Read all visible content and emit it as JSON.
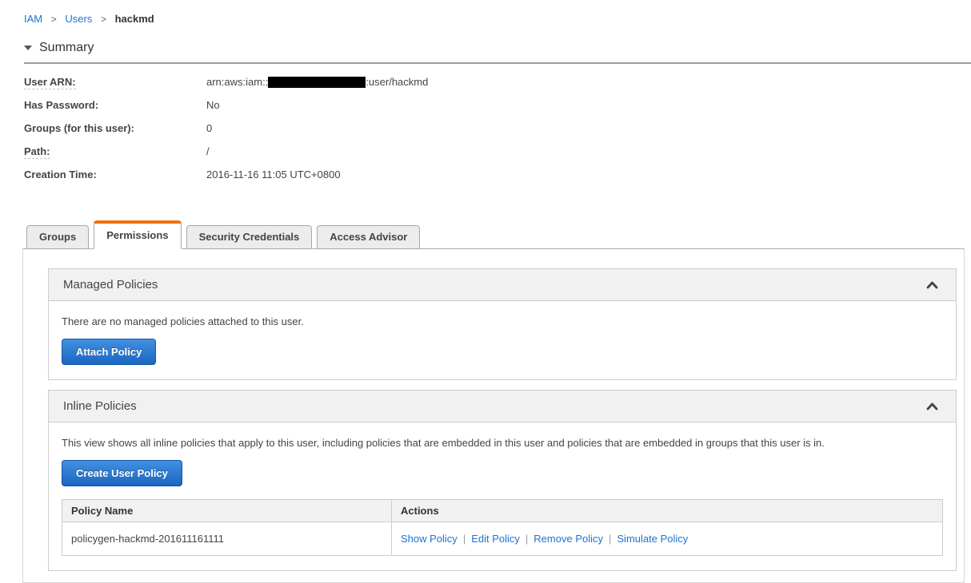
{
  "breadcrumb": {
    "separator": ">",
    "items": [
      {
        "label": "IAM"
      },
      {
        "label": "Users"
      },
      {
        "label": "hackmd"
      }
    ]
  },
  "summary": {
    "title": "Summary",
    "fields": [
      {
        "label": "User ARN:",
        "value_prefix": "arn:aws:iam::",
        "value_redacted": "[account-id-redacted]",
        "value_suffix": ":user/hackmd"
      },
      {
        "label": "Has Password:",
        "value": "No"
      },
      {
        "label": "Groups (for this user):",
        "value": "0"
      },
      {
        "label": "Path:",
        "value": "/"
      },
      {
        "label": "Creation Time:",
        "value": "2016-11-16 11:05 UTC+0800"
      }
    ]
  },
  "tabs": [
    {
      "label": "Groups",
      "active": false
    },
    {
      "label": "Permissions",
      "active": true
    },
    {
      "label": "Security Credentials",
      "active": false
    },
    {
      "label": "Access Advisor",
      "active": false
    }
  ],
  "managed_policies": {
    "title": "Managed Policies",
    "empty_text": "There are no managed policies attached to this user.",
    "attach_button_label": "Attach Policy",
    "collapse_icon": "chevron-up"
  },
  "inline_policies": {
    "title": "Inline Policies",
    "description": "This view shows all inline policies that apply to this user, including policies that are embedded in this user and policies that are embedded in groups that this user is in.",
    "create_button_label": "Create User Policy",
    "collapse_icon": "chevron-up",
    "table": {
      "headers": [
        "Policy Name",
        "Actions"
      ],
      "actions_separator": "|",
      "rows": [
        {
          "policy_name": "policygen-hackmd-201611161111",
          "actions": [
            "Show Policy",
            "Edit Policy",
            "Remove Policy",
            "Simulate Policy"
          ]
        }
      ]
    }
  },
  "colors": {
    "link_blue": "#1e73d2",
    "accent_orange": "#ec7211",
    "button_blue_top": "#4290e0",
    "button_blue_bottom": "#1a66c2",
    "section_header_gray": "#f1f1f1",
    "redaction_black": "#000000"
  }
}
